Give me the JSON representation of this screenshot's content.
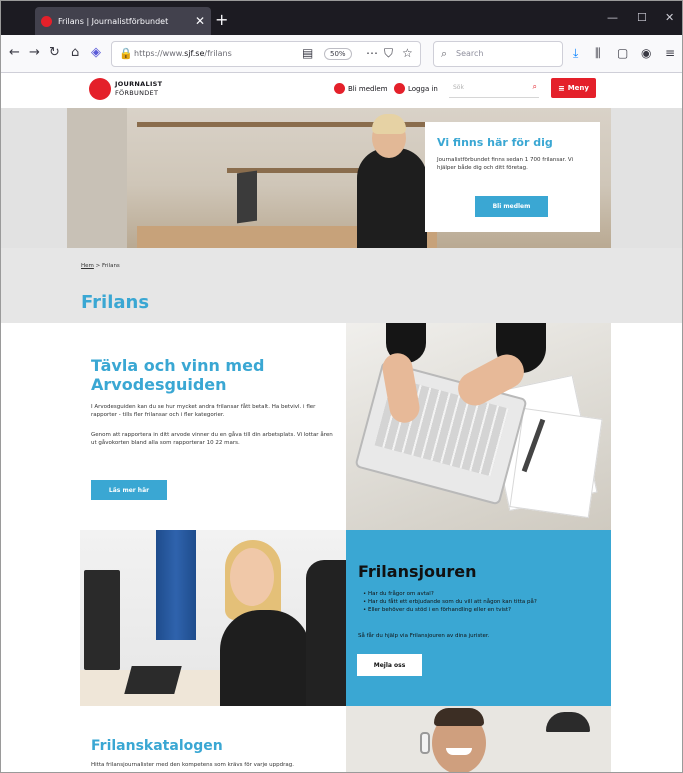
{
  "browser": {
    "tab_title": "Frilans | Journalistförbundet",
    "tab_close": "✕",
    "new_tab": "+",
    "url_prefix": "https://www.",
    "url_domain": "sjf.se",
    "url_path": "/frilans",
    "zoom": "50%",
    "search_placeholder": "Search",
    "window_controls": [
      "—",
      "☐",
      "✕"
    ]
  },
  "site": {
    "logo_line1": "JOURNALIST",
    "logo_line2": "FÖRBUNDET",
    "nav_join": "Bli medlem",
    "nav_login": "Logga in",
    "search_placeholder": "Sök",
    "menu_label": "Meny"
  },
  "hero": {
    "card_title": "Vi finns här för dig",
    "card_text": "Journalistförbundet finns sedan 1 700 frilansar. Vi hjälper både dig och ditt företag.",
    "card_button": "Bli medlem"
  },
  "page": {
    "breadcrumb_home": "Hem",
    "breadcrumb_sep": ">",
    "breadcrumb_current": "Frilans",
    "title": "Frilans"
  },
  "block_arvode": {
    "title": "Tävla och vinn med Arvodesguiden",
    "p1": "I Arvodesguiden kan du se hur mycket andra frilansar fått betalt. Ha betvivl. i fler rapporter - tills fler frilansar och i fler kategorier.",
    "p2": "Genom att rapportera in ditt arvode vinner du en gåva till din arbetsplats. Vi lottar åren ut gåvokorten bland alla som rapporterar 10 22 mars.",
    "button": "Läs mer här"
  },
  "block_jouren": {
    "title": "Frilansjouren",
    "items": [
      "Har du frågor om avtal?",
      "Har du fått ett erbjudande som du vill att någon kan titta på?",
      "Eller behöver du stöd i en förhandling eller en tvist?"
    ],
    "text": "Så får du hjälp via Frilansjouren av dina jurister.",
    "button": "Mejla oss"
  },
  "block_katalog": {
    "title": "Frilanskatalogen",
    "text": "Hitta frilansjournalister med den kompetens som krävs för varje uppdrag."
  }
}
